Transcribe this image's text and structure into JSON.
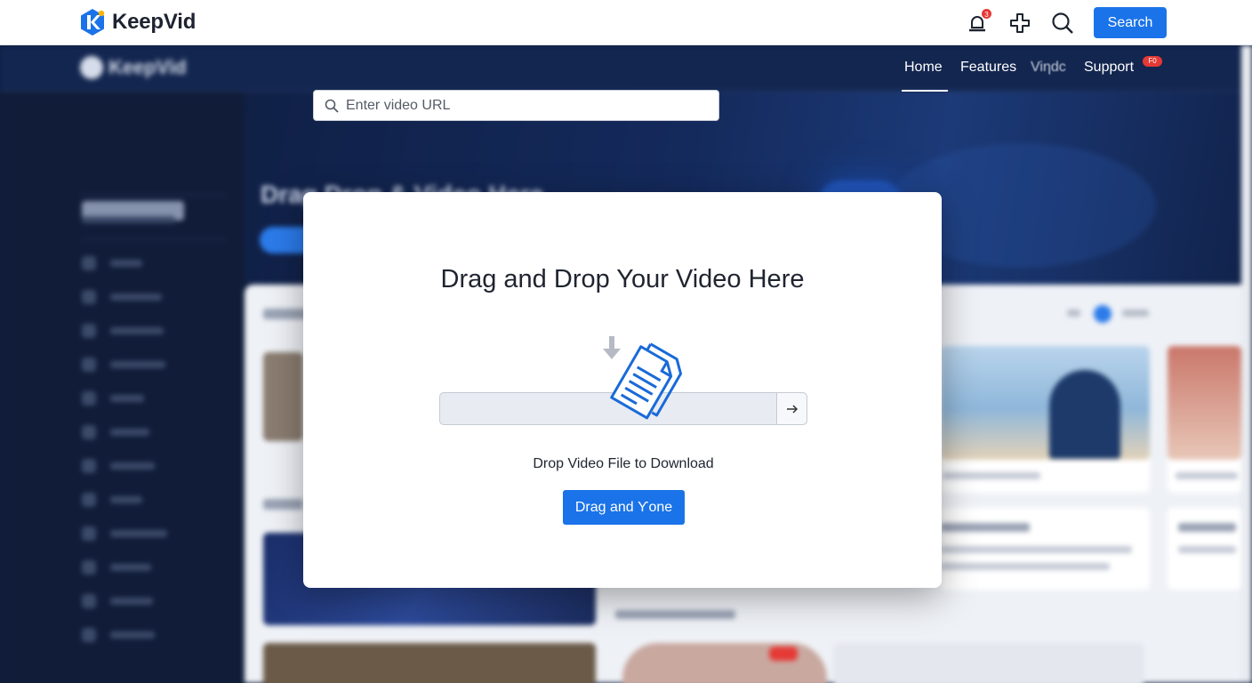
{
  "app": {
    "brand_name": "KeepVid",
    "notification_count": "3",
    "search_button_label": "Search"
  },
  "site_nav": {
    "logo_text": "KeepVid",
    "links": [
      "Home",
      "Features",
      "Viηdϲ",
      "Support"
    ],
    "active": "Home",
    "support_badge": "F0"
  },
  "url_search": {
    "placeholder": "Enter video URL"
  },
  "background": {
    "hero_title": "Drag Drop & Video Here"
  },
  "modal": {
    "title": "Drag and Drop Your Video Here",
    "drop_label": "Drop Video File to Download",
    "button_label": "Drag and Ƴone"
  },
  "colors": {
    "accent": "#1a73e8",
    "nav_bg": "#132650",
    "badge": "#e53935"
  },
  "icons": [
    "keepvid-logo-icon",
    "bell-icon",
    "plus-icon",
    "search-icon",
    "arrow-right-icon",
    "download-arrow-icon",
    "document-icon"
  ]
}
